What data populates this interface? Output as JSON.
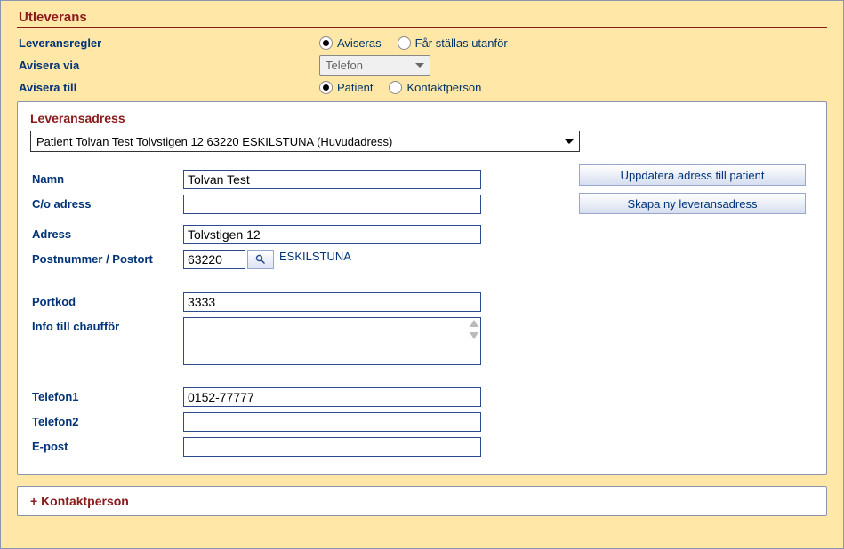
{
  "section_title": "Utleverans",
  "rows": {
    "leveransregler": {
      "label": "Leveransregler",
      "opt1": "Aviseras",
      "opt2": "Får ställas utanför"
    },
    "avisera_via": {
      "label": "Avisera via",
      "value": "Telefon"
    },
    "avisera_till": {
      "label": "Avisera till",
      "opt1": "Patient",
      "opt2": "Kontaktperson"
    }
  },
  "panel_title": "Leveransadress",
  "address_select": "Patient Tolvan Test Tolvstigen 12 63220 ESKILSTUNA (Huvudadress)",
  "buttons": {
    "update": "Uppdatera adress till patient",
    "create": "Skapa ny leveransadress"
  },
  "form": {
    "namn_label": "Namn",
    "namn_value": "Tolvan Test",
    "co_label": "C/o adress",
    "co_value": "",
    "adress_label": "Adress",
    "adress_value": "Tolvstigen 12",
    "post_label": "Postnummer / Postort",
    "postnr_value": "63220",
    "postort_value": "ESKILSTUNA",
    "portkod_label": "Portkod",
    "portkod_value": "3333",
    "info_label": "Info till chaufför",
    "info_value": "",
    "tel1_label": "Telefon1",
    "tel1_value": "0152-77777",
    "tel2_label": "Telefon2",
    "tel2_value": "",
    "epost_label": "E-post",
    "epost_value": ""
  },
  "kontakt_title": "+ Kontaktperson"
}
